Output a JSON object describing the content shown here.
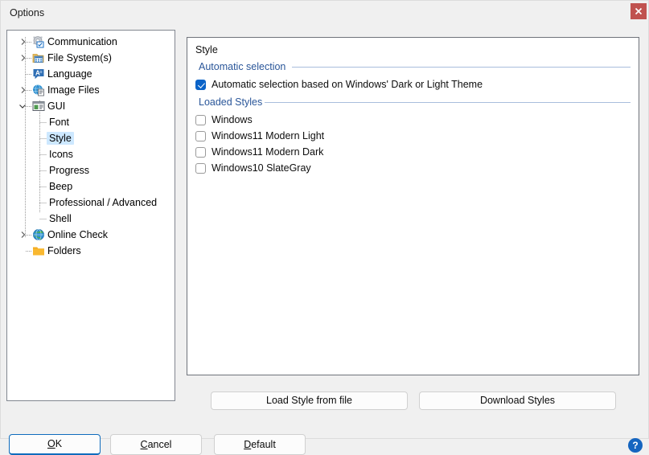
{
  "window": {
    "title": "Options",
    "close_icon": "close-icon"
  },
  "tree": {
    "items": [
      {
        "label": "Communication",
        "icon": "gear-checkbox-icon",
        "depth": 0,
        "expandable": true,
        "expanded": false,
        "selected": false
      },
      {
        "label": "File System(s)",
        "icon": "folder-grid-icon",
        "depth": 0,
        "expandable": true,
        "expanded": false,
        "selected": false
      },
      {
        "label": "Language",
        "icon": "speech-a-icon",
        "depth": 0,
        "expandable": false,
        "expanded": false,
        "selected": false
      },
      {
        "label": "Image Files",
        "icon": "image-globe-icon",
        "depth": 0,
        "expandable": true,
        "expanded": false,
        "selected": false
      },
      {
        "label": "GUI",
        "icon": "window-icon",
        "depth": 0,
        "expandable": true,
        "expanded": true,
        "selected": false
      },
      {
        "label": "Font",
        "icon": "",
        "depth": 1,
        "expandable": false,
        "expanded": false,
        "selected": false
      },
      {
        "label": "Style",
        "icon": "",
        "depth": 1,
        "expandable": false,
        "expanded": false,
        "selected": true
      },
      {
        "label": "Icons",
        "icon": "",
        "depth": 1,
        "expandable": false,
        "expanded": false,
        "selected": false
      },
      {
        "label": "Progress",
        "icon": "",
        "depth": 1,
        "expandable": false,
        "expanded": false,
        "selected": false
      },
      {
        "label": "Beep",
        "icon": "",
        "depth": 1,
        "expandable": false,
        "expanded": false,
        "selected": false
      },
      {
        "label": "Professional / Advanced",
        "icon": "",
        "depth": 1,
        "expandable": false,
        "expanded": false,
        "selected": false
      },
      {
        "label": "Shell",
        "icon": "",
        "depth": 1,
        "expandable": false,
        "expanded": false,
        "selected": false
      },
      {
        "label": "Online Check",
        "icon": "globe-icon",
        "depth": 0,
        "expandable": true,
        "expanded": false,
        "selected": false
      },
      {
        "label": "Folders",
        "icon": "folder-icon",
        "depth": 0,
        "expandable": false,
        "expanded": false,
        "selected": false
      }
    ]
  },
  "style_panel": {
    "title": "Style",
    "sections": {
      "automatic_selection": {
        "title": "Automatic selection",
        "checkbox": {
          "label": "Automatic selection based on Windows' Dark or Light Theme",
          "checked": true
        }
      },
      "loaded_styles": {
        "title": "Loaded Styles",
        "items": [
          {
            "label": "Windows",
            "checked": false
          },
          {
            "label": "Windows11 Modern Light",
            "checked": false
          },
          {
            "label": "Windows11 Modern Dark",
            "checked": false
          },
          {
            "label": "Windows10 SlateGray",
            "checked": false
          }
        ]
      }
    }
  },
  "style_actions": {
    "load_from_file": "Load Style from file",
    "download_styles": "Download Styles"
  },
  "dialog_buttons": {
    "ok": {
      "accel": "O",
      "rest": "K"
    },
    "cancel": {
      "accel": "C",
      "rest": "ancel"
    },
    "default": {
      "accel": "D",
      "rest": "efault"
    }
  },
  "help": {
    "label": "?",
    "icon": "help-icon"
  },
  "colors": {
    "accent": "#0a63c8",
    "section_title": "#2a5699",
    "selection": "#cde8ff",
    "close_button": "#c0524f",
    "help_button": "#1565c0",
    "window_bg": "#f0f0f0",
    "panel_bg": "#ffffff"
  }
}
